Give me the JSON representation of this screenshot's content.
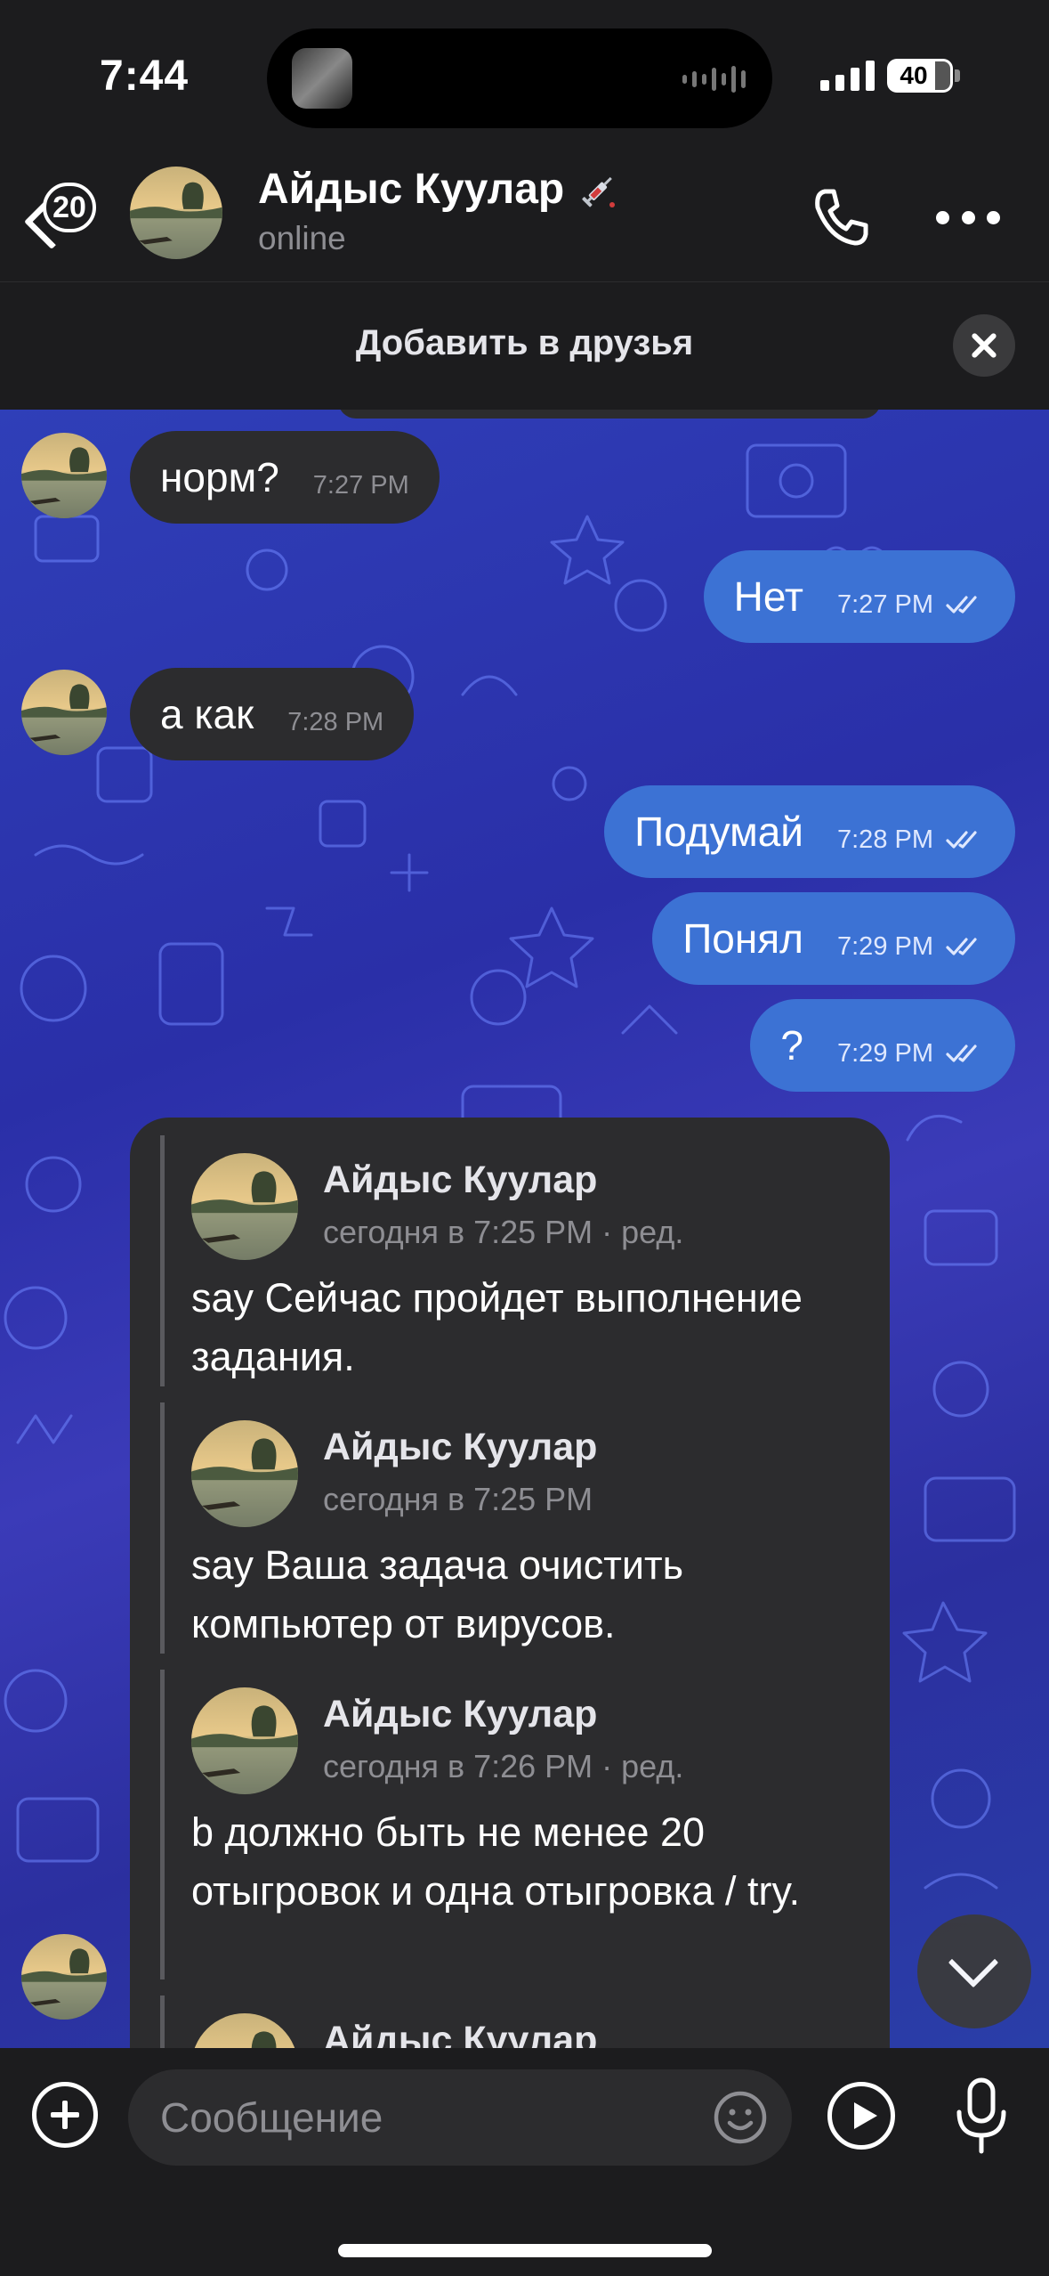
{
  "status_bar": {
    "time": "7:44",
    "battery": "40"
  },
  "header": {
    "back_badge": "20",
    "name": "Айдыс Куулар",
    "status": "online",
    "name_icon": "syringe-icon"
  },
  "add_friend": {
    "label": "Добавить в друзья"
  },
  "messages": [
    {
      "direction": "in",
      "text": "норм?",
      "time": "7:27 PM"
    },
    {
      "direction": "out",
      "text": "Нет",
      "time": "7:27 PM",
      "read": true
    },
    {
      "direction": "in",
      "text": "а как",
      "time": "7:28 PM"
    },
    {
      "direction": "out",
      "text": "Подумай",
      "time": "7:28 PM",
      "read": true
    },
    {
      "direction": "out",
      "text": "Понял",
      "time": "7:29 PM",
      "read": true
    },
    {
      "direction": "out",
      "text": "?",
      "time": "7:29 PM",
      "read": true
    }
  ],
  "forwarded": [
    {
      "name": "Айдыс Куулар",
      "meta": "сегодня в 7:25 PM · ред.",
      "text": "say Сейчас пройдет выполнение задания."
    },
    {
      "name": "Айдыс Куулар",
      "meta": "сегодня в 7:25 PM",
      "text": "say Ваша задача очистить компьютер от вирусов."
    },
    {
      "name": "Айдыс Куулар",
      "meta": "сегодня в 7:26 PM · ред.",
      "text": "b должно быть не менее 20 отыгровок и одна отыгровка / try."
    },
    {
      "name": "Айдыс Куулар"
    }
  ],
  "composer": {
    "placeholder": "Сообщение"
  },
  "colors": {
    "outgoing_bubble": "#3c72d4",
    "incoming_bubble": "#2c2c2e",
    "bar_background": "#1c1c1e"
  }
}
